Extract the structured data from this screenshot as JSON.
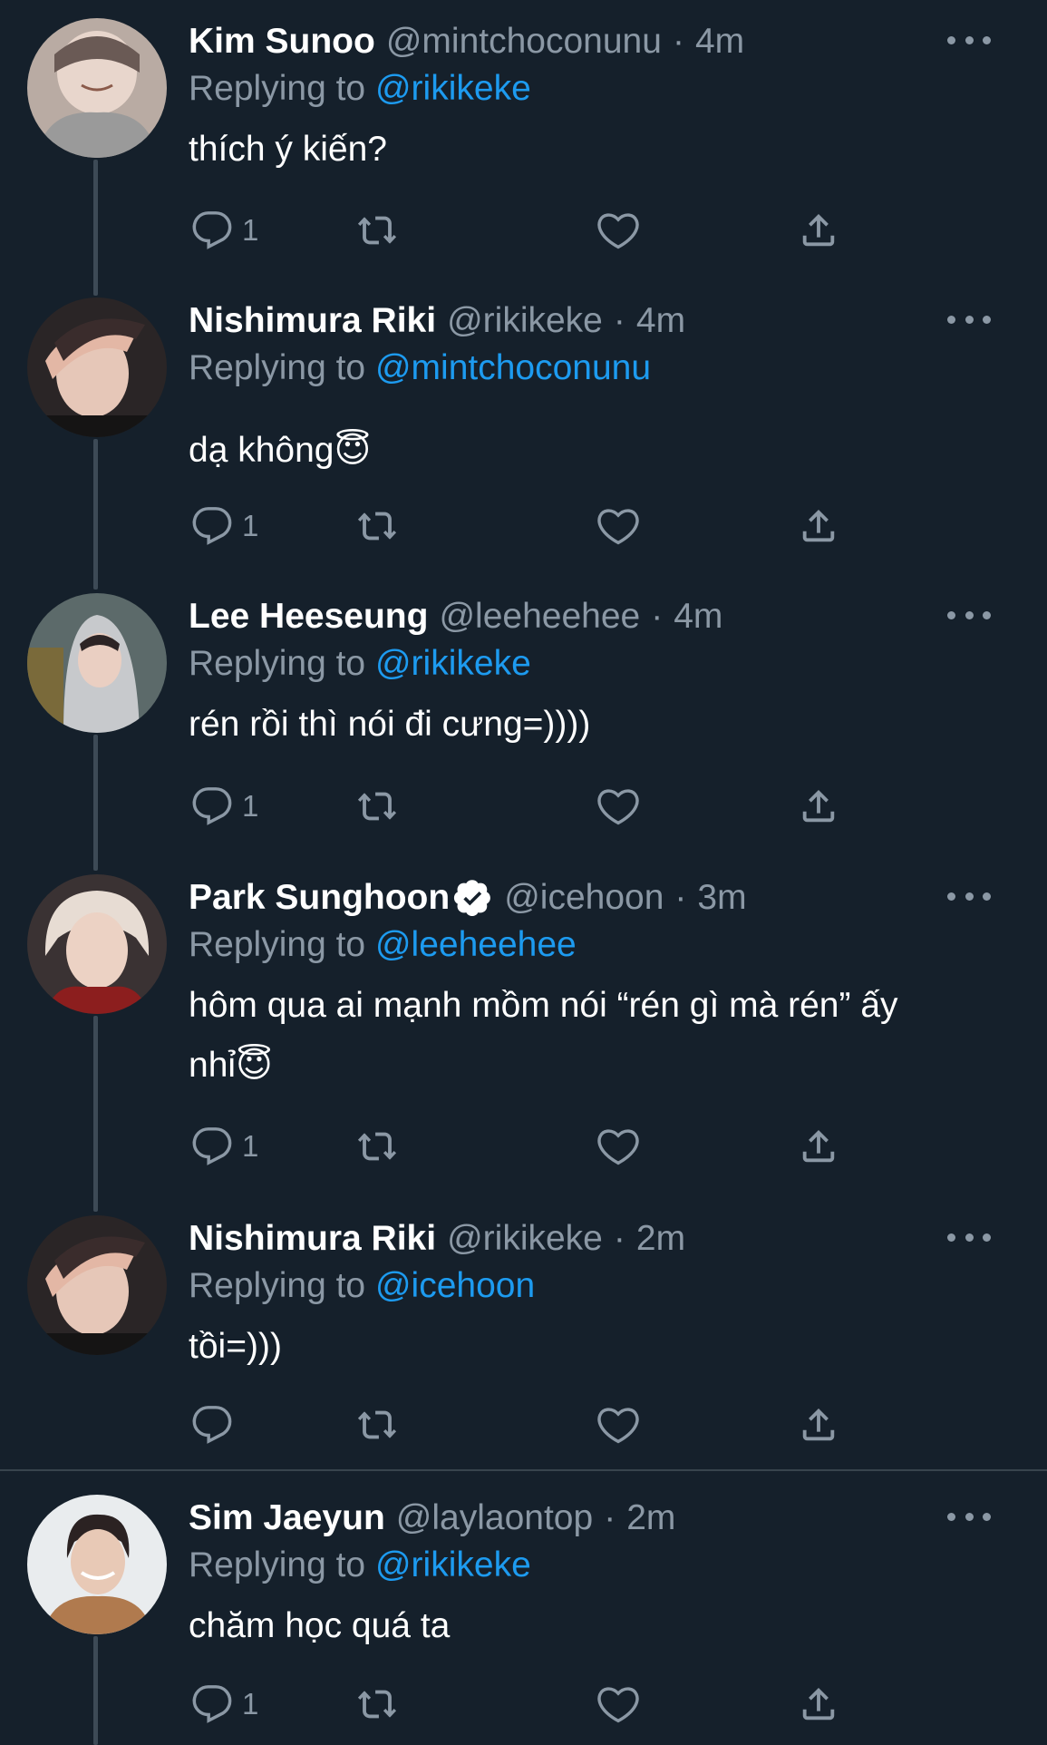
{
  "colors": {
    "background": "#15202b",
    "secondary_text": "#8b98a5",
    "mention": "#1d9bf0",
    "thread_line": "#3d4a56",
    "divider": "#38444d"
  },
  "replying_prefix": "Replying to",
  "tweets": [
    {
      "name": "Kim Sunoo",
      "handle": "@mintchoconunu",
      "sep": "·",
      "time": "4m",
      "reply_to": "@rikikeke",
      "text": "thích ý kiến?",
      "reply_count": "1",
      "verified": false,
      "avatar": "avatar-kim-sunoo"
    },
    {
      "name": "Nishimura Riki",
      "handle": "@rikikeke",
      "sep": "·",
      "time": "4m",
      "reply_to": "@mintchoconunu",
      "text": "dạ không😇",
      "reply_count": "1",
      "verified": false,
      "avatar": "avatar-nishimura-riki"
    },
    {
      "name": "Lee Heeseung",
      "handle": "@leeheehee",
      "sep": "·",
      "time": "4m",
      "reply_to": "@rikikeke",
      "text": "rén rồi thì nói đi cưng=))))",
      "reply_count": "1",
      "verified": false,
      "avatar": "avatar-lee-heeseung"
    },
    {
      "name": "Park Sunghoon",
      "handle": "@icehoon",
      "sep": "·",
      "time": "3m",
      "reply_to": "@leeheehee",
      "text_line1": "hôm qua ai mạnh mồm nói “rén gì mà rén” ấy",
      "text_line2": "nhỉ😇",
      "reply_count": "1",
      "verified": true,
      "avatar": "avatar-park-sunghoon"
    },
    {
      "name": "Nishimura Riki",
      "handle": "@rikikeke",
      "sep": "·",
      "time": "2m",
      "reply_to": "@icehoon",
      "text": "tồi=)))",
      "reply_count": "",
      "verified": false,
      "avatar": "avatar-nishimura-riki"
    },
    {
      "name": "Sim Jaeyun",
      "handle": "@laylaontop",
      "sep": "·",
      "time": "2m",
      "reply_to": "@rikikeke",
      "text": "chăm học quá ta",
      "reply_count": "1",
      "verified": false,
      "avatar": "avatar-sim-jaeyun"
    }
  ],
  "icons": {
    "reply": "reply-icon",
    "retweet": "retweet-icon",
    "like": "heart-icon",
    "share": "share-icon",
    "more": "more-icon",
    "verified": "verified-badge-icon"
  }
}
